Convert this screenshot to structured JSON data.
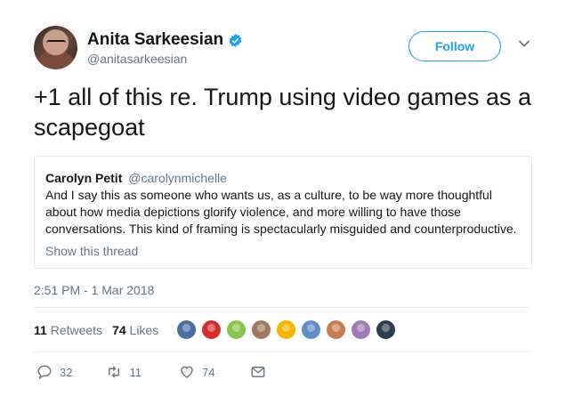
{
  "author": {
    "name": "Anita Sarkeesian",
    "handle": "@anitasarkeesian"
  },
  "follow_label": "Follow",
  "tweet_text": "+1 all of this re. Trump using video games as a scapegoat",
  "quote": {
    "name": "Carolyn Petit",
    "handle": "@carolynmichelle",
    "lines": [
      "And I say this as someone who wants us, as a culture, to be way more thoughtful",
      "about how media depictions glorify violence, and more willing to have those",
      "conversations. This kind of framing is spectacularly misguided and counterproductive."
    ],
    "show_thread": "Show this thread"
  },
  "timestamp": "2:51 PM - 1 Mar 2018",
  "stats": {
    "retweets_count": "11",
    "retweets_label": "Retweets",
    "likes_count": "74",
    "likes_label": "Likes"
  },
  "likers": [
    {
      "icon": "liker-avatar-cat",
      "color": "#4a6fa5"
    },
    {
      "icon": "liker-avatar-red-eyes",
      "color": "#d32f2f"
    },
    {
      "icon": "liker-avatar-sick-face",
      "color": "#8bc34a"
    },
    {
      "icon": "liker-avatar-woman",
      "color": "#a0785f"
    },
    {
      "icon": "liker-avatar-rainbow",
      "color": "#f4b400"
    },
    {
      "icon": "liker-avatar-cartoon",
      "color": "#5c8ec7"
    },
    {
      "icon": "liker-avatar-redhead",
      "color": "#c77d52"
    },
    {
      "icon": "liker-avatar-anime",
      "color": "#9e7bb5"
    },
    {
      "icon": "liker-avatar-dark",
      "color": "#2c3e50"
    }
  ],
  "actions": {
    "reply_count": "32",
    "retweet_count": "11",
    "like_count": "74"
  },
  "colors": {
    "accent": "#1da1f2",
    "muted": "#657786",
    "text": "#14171a"
  }
}
